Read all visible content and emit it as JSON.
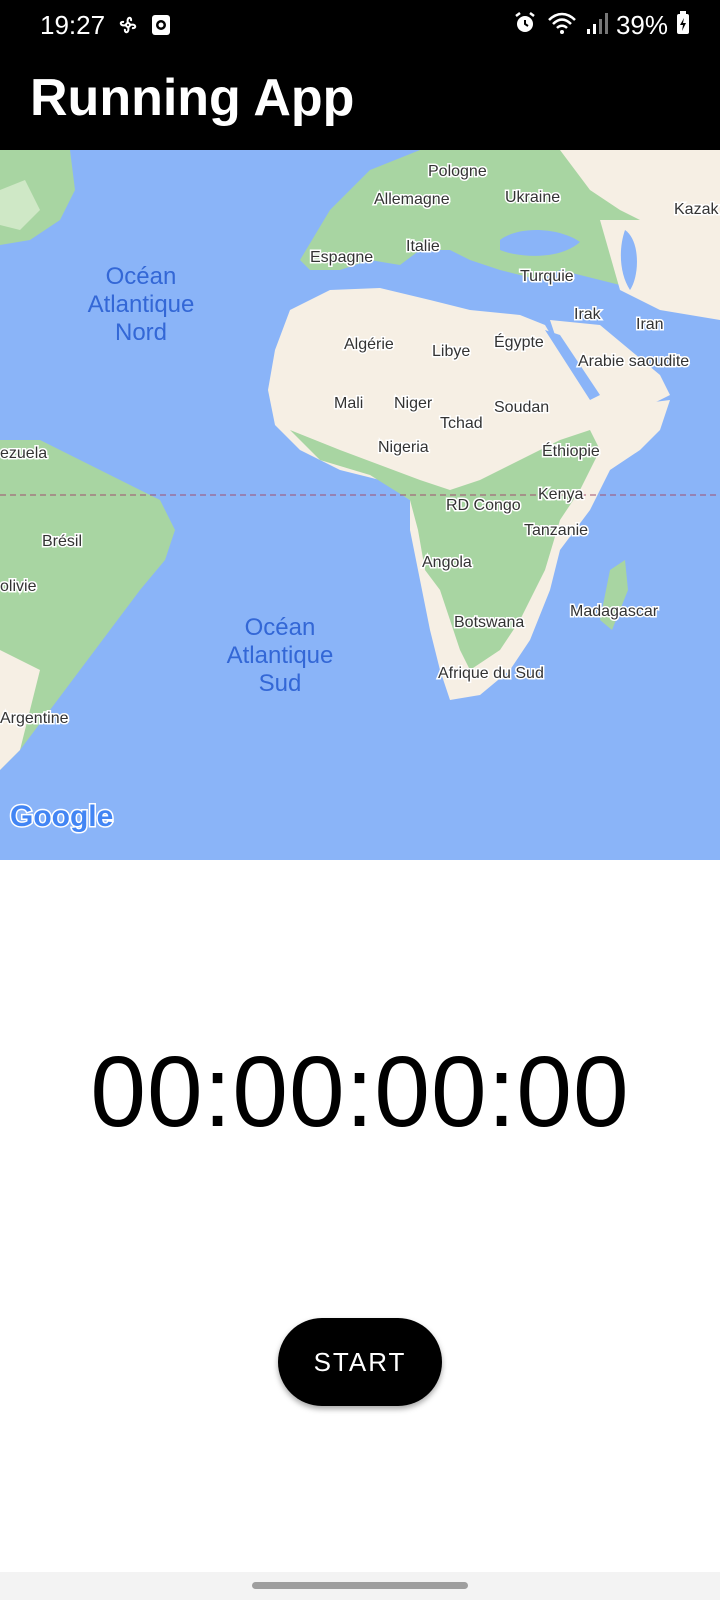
{
  "status_bar": {
    "time": "19:27",
    "battery": "39%",
    "icons": [
      "fan-icon",
      "screen-record-icon",
      "alarm-icon",
      "wifi-icon",
      "signal-icon",
      "battery-icon"
    ]
  },
  "app_bar": {
    "title": "Running App"
  },
  "map": {
    "provider": "Google",
    "countries": [
      {
        "key": "pologne",
        "label": "Pologne"
      },
      {
        "key": "allemagne",
        "label": "Allemagne"
      },
      {
        "key": "ukraine",
        "label": "Ukraine"
      },
      {
        "key": "kazak",
        "label": "Kazak"
      },
      {
        "key": "italie",
        "label": "Italie"
      },
      {
        "key": "espagne",
        "label": "Espagne"
      },
      {
        "key": "turquie",
        "label": "Turquie"
      },
      {
        "key": "algerie",
        "label": "Algérie"
      },
      {
        "key": "libye",
        "label": "Libye"
      },
      {
        "key": "egypte",
        "label": "Égypte"
      },
      {
        "key": "irak",
        "label": "Irak"
      },
      {
        "key": "iran",
        "label": "Iran"
      },
      {
        "key": "arabie",
        "label": "Arabie saoudite"
      },
      {
        "key": "mali",
        "label": "Mali"
      },
      {
        "key": "niger",
        "label": "Niger"
      },
      {
        "key": "tchad",
        "label": "Tchad"
      },
      {
        "key": "soudan",
        "label": "Soudan"
      },
      {
        "key": "nigeria",
        "label": "Nigeria"
      },
      {
        "key": "ethiopie",
        "label": "Éthiopie"
      },
      {
        "key": "venezuela",
        "label": "ezuela"
      },
      {
        "key": "kenya",
        "label": "Kenya"
      },
      {
        "key": "rdcongo",
        "label": "RD Congo"
      },
      {
        "key": "tanzanie",
        "label": "Tanzanie"
      },
      {
        "key": "bresil",
        "label": "Brésil"
      },
      {
        "key": "angola",
        "label": "Angola"
      },
      {
        "key": "bolivie",
        "label": "olivie"
      },
      {
        "key": "madagascar",
        "label": "Madagascar"
      },
      {
        "key": "botswana",
        "label": "Botswana"
      },
      {
        "key": "afriquesud",
        "label": "Afrique du Sud"
      },
      {
        "key": "argentine",
        "label": "Argentine"
      }
    ],
    "oceans": [
      {
        "key": "nord",
        "line1": "Océan",
        "line2": "Atlantique",
        "line3": "Nord"
      },
      {
        "key": "sud",
        "line1": "Océan",
        "line2": "Atlantique",
        "line3": "Sud"
      }
    ]
  },
  "timer": {
    "value": "00:00:00:00"
  },
  "start_button": {
    "label": "START"
  }
}
